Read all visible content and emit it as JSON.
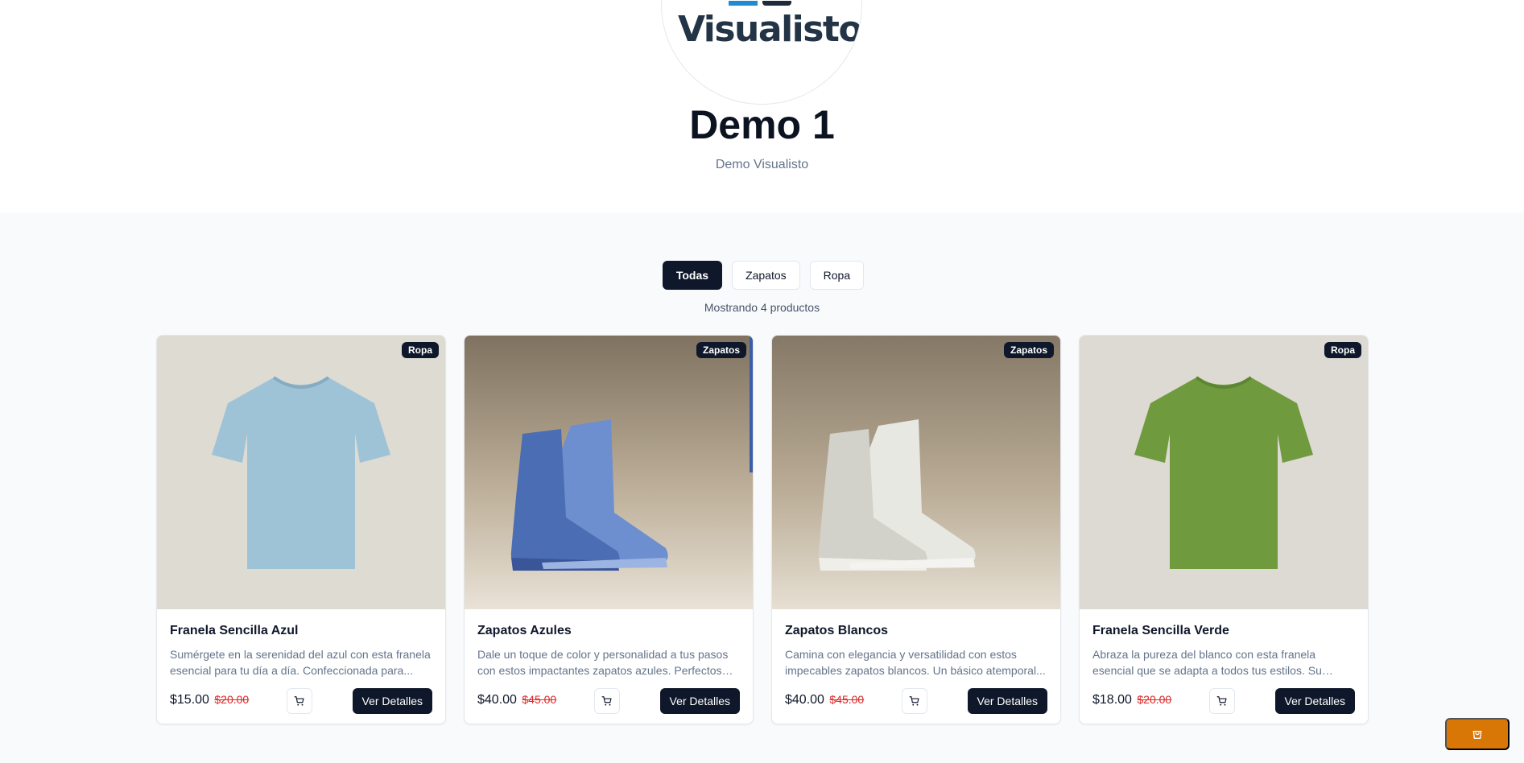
{
  "header": {
    "logo_text": "Visualisto",
    "logo_reg": "®",
    "title": "Demo 1",
    "subtitle": "Demo Visualisto"
  },
  "filters": {
    "items": [
      {
        "label": "Todas",
        "active": true
      },
      {
        "label": "Zapatos",
        "active": false
      },
      {
        "label": "Ropa",
        "active": false
      }
    ],
    "count_text": "Mostrando 4 productos"
  },
  "products": [
    {
      "badge": "Ropa",
      "name": "Franela Sencilla Azul",
      "description": "Sumérgete en la serenidad del azul con esta franela esencial para tu día a día. Confeccionada para...",
      "price": "$15.00",
      "old_price": "$20.00",
      "button": "Ver Detalles",
      "image": "light-blue-tshirt",
      "color": "#9fc3d6"
    },
    {
      "badge": "Zapatos",
      "name": "Zapatos Azules",
      "description": "Dale un toque de color y personalidad a tus pasos con estos impactantes zapatos azules. Perfectos pa...",
      "price": "$40.00",
      "old_price": "$45.00",
      "button": "Ver Detalles",
      "image": "blue-high-top-sneakers",
      "color": "#5b7fc4"
    },
    {
      "badge": "Zapatos",
      "name": "Zapatos Blancos",
      "description": "Camina con elegancia y versatilidad con estos impecables zapatos blancos. Un básico atemporal...",
      "price": "$40.00",
      "old_price": "$45.00",
      "button": "Ver Detalles",
      "image": "white-high-top-sneakers",
      "color": "#d9d9d4"
    },
    {
      "badge": "Ropa",
      "name": "Franela Sencilla Verde",
      "description": "Abraza la pureza del blanco con esta franela esencial que se adapta a todos tus estilos. Su versatilidad te...",
      "price": "$18.00",
      "old_price": "$20.00",
      "button": "Ver Detalles",
      "image": "green-tshirt",
      "color": "#6f9a3e"
    }
  ],
  "floating_cart": {
    "icon": "shopping-bag-icon",
    "color": "#d97706"
  }
}
